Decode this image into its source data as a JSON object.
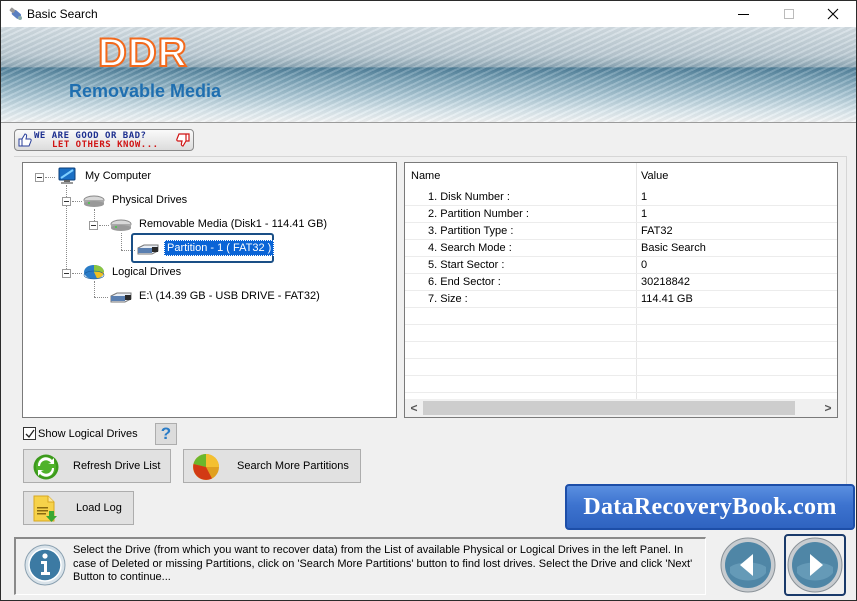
{
  "window": {
    "title": "Basic Search",
    "controls": {
      "minimize": "minimize",
      "maximize": "maximize",
      "close": "close"
    }
  },
  "banner": {
    "brand": "DDR",
    "product": "Removable Media"
  },
  "rating": {
    "line1": "WE ARE GOOD OR BAD?",
    "line2": "LET OTHERS KNOW..."
  },
  "tree": {
    "nodes": [
      {
        "label": "My Computer",
        "icon": "computer-icon",
        "level": 0,
        "expanded": true
      },
      {
        "label": "Physical Drives",
        "icon": "hard-drive-icon",
        "level": 1,
        "expanded": true
      },
      {
        "label": "Removable Media (Disk1 - 114.41 GB)",
        "icon": "hard-drive-icon",
        "level": 2,
        "expanded": true
      },
      {
        "label": "Partition - 1 ( FAT32 )",
        "icon": "usb-drive-icon",
        "level": 3,
        "selected": true
      },
      {
        "label": "Logical Drives",
        "icon": "pie-disk-icon",
        "level": 1,
        "expanded": true
      },
      {
        "label": "E:\\ (14.39 GB - USB DRIVE - FAT32)",
        "icon": "usb-drive-icon",
        "level": 2
      }
    ]
  },
  "properties": {
    "columns": {
      "name": "Name",
      "value": "Value"
    },
    "rows": [
      {
        "name": "1. Disk Number :",
        "value": "1"
      },
      {
        "name": "2. Partition Number :",
        "value": "1"
      },
      {
        "name": "3. Partition Type :",
        "value": "FAT32"
      },
      {
        "name": "4. Search Mode :",
        "value": "Basic Search"
      },
      {
        "name": "5. Start Sector :",
        "value": "0"
      },
      {
        "name": "6. End Sector :",
        "value": "30218842"
      },
      {
        "name": "7. Size :",
        "value": "114.41 GB"
      }
    ],
    "scroll_left": "<",
    "scroll_right": ">"
  },
  "controls": {
    "show_logical_drives": {
      "label": "Show Logical Drives",
      "checked": true
    },
    "help": "?",
    "refresh_label": "Refresh Drive List",
    "search_more_label": "Search More Partitions",
    "load_log_label": "Load Log"
  },
  "site_badge": "DataRecoveryBook.com",
  "info": {
    "text": "Select the Drive (from which you want to recover data) from the List of available Physical or Logical Drives in the left Panel. In case of Deleted or missing Partitions, click on 'Search More Partitions' button to find lost drives. Select the Drive and click 'Next' Button to continue..."
  },
  "colors": {
    "brand_orange": "#f2691c",
    "product_blue": "#1f6fb0",
    "selection_blue": "#0a64d6",
    "badge_blue": "#3d73cf"
  }
}
